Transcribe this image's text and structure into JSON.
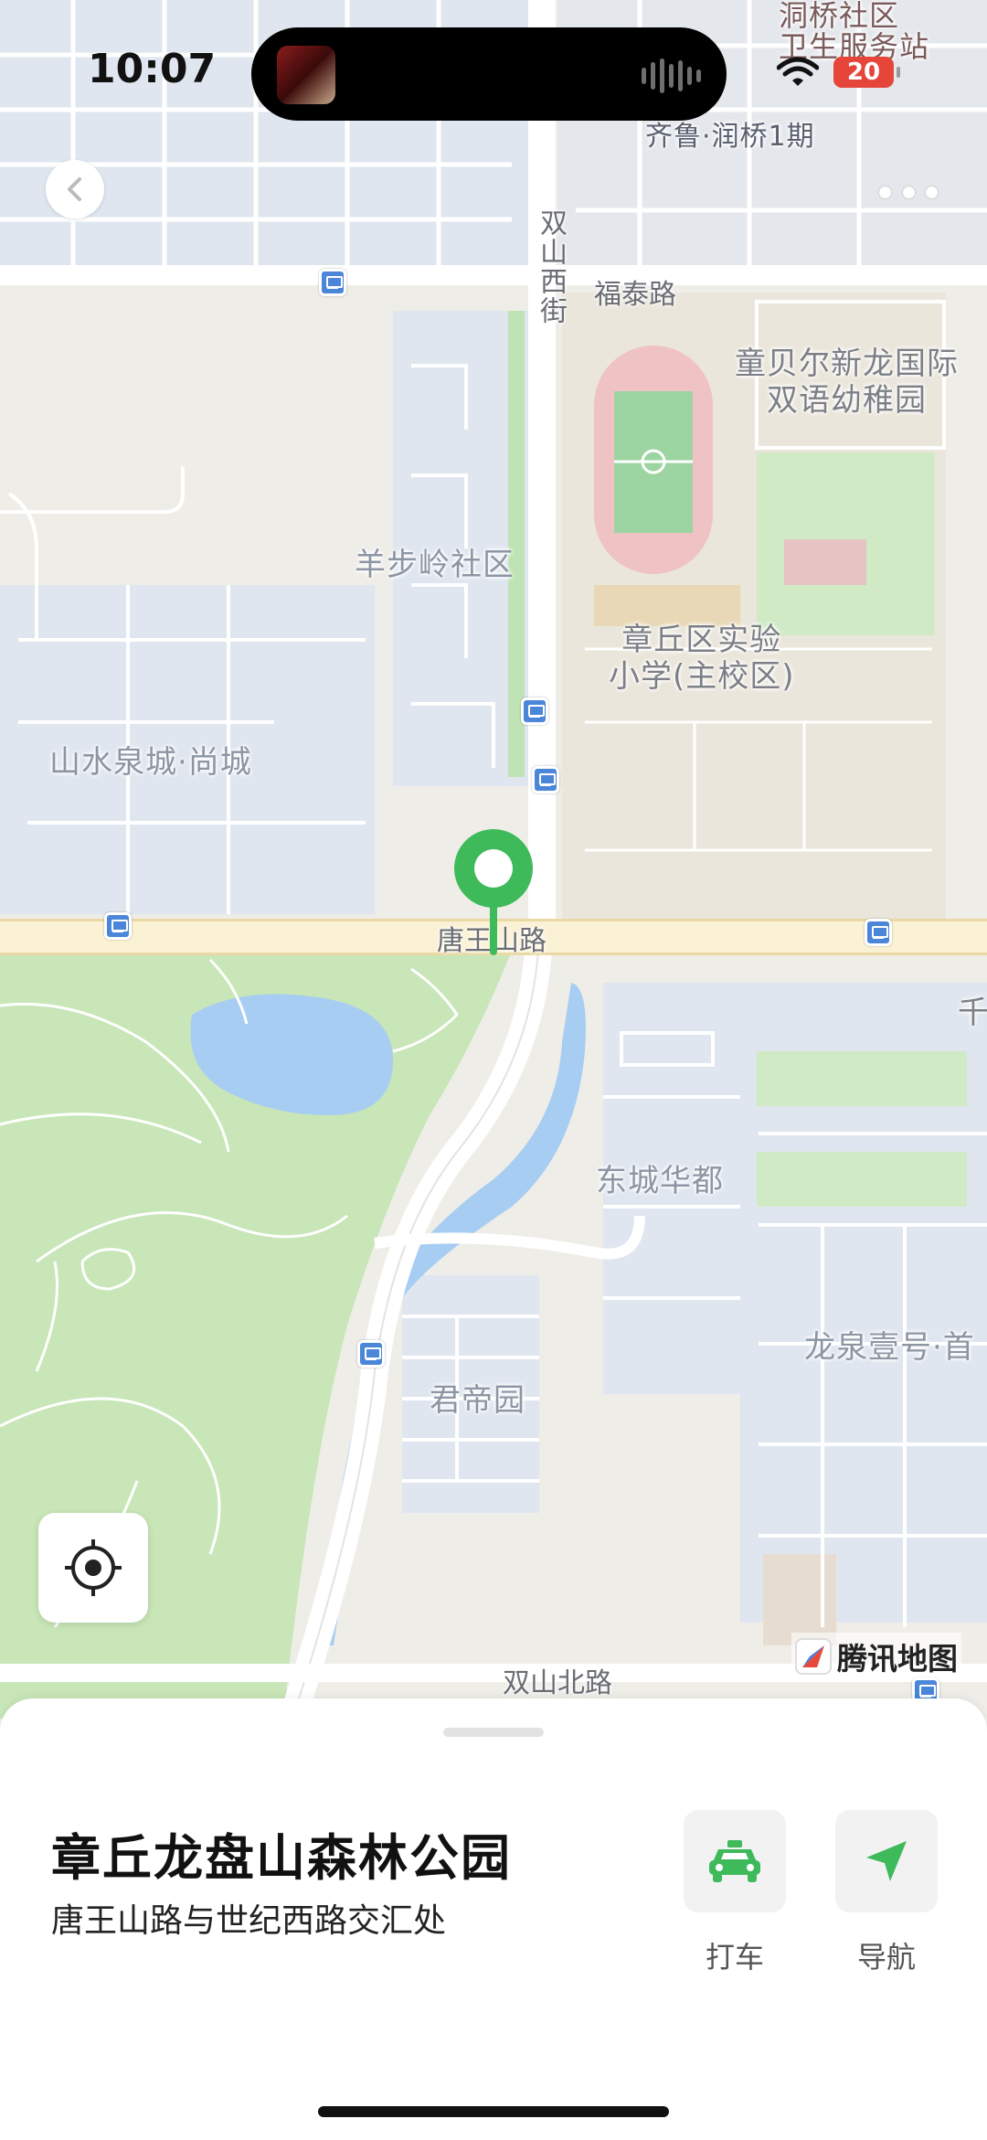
{
  "status_bar": {
    "time": "10:07",
    "battery": "20"
  },
  "map": {
    "labels": {
      "runqiao_health": "洞桥社区\n卫生服务站",
      "qilu_runqiao": "齐鲁·润桥1期",
      "shuangshan_west": "双山西街",
      "futai_road": "福泰路",
      "kindergarten": "童贝尔新龙国际\n双语幼稚园",
      "yangbuling": "羊步岭社区",
      "primary_school": "章丘区实验\n小学(主校区)",
      "shanshui": "山水泉城·尚城",
      "tangwangshan_road": "唐王山路",
      "qian": "千",
      "dongcheng": "东城华都",
      "longquan": "龙泉壹号·首",
      "jundi": "君帝园",
      "shuangshan_north": "双山北路"
    },
    "logo_text": "腾讯地图"
  },
  "place": {
    "name": "章丘龙盘山森林公园",
    "address": "唐王山路与世纪西路交汇处"
  },
  "actions": {
    "taxi_label": "打车",
    "navigate_label": "导航"
  },
  "colors": {
    "accent_green": "#3fba5a",
    "park_green": "#c8e6b8",
    "water_blue": "#a7cdf2",
    "residential_blue": "#dde7f3"
  },
  "icons": [
    "back-icon",
    "more-icon",
    "map-pin-icon",
    "locate-icon",
    "taxi-icon",
    "navigation-arrow-icon",
    "bus-stop-icon"
  ]
}
